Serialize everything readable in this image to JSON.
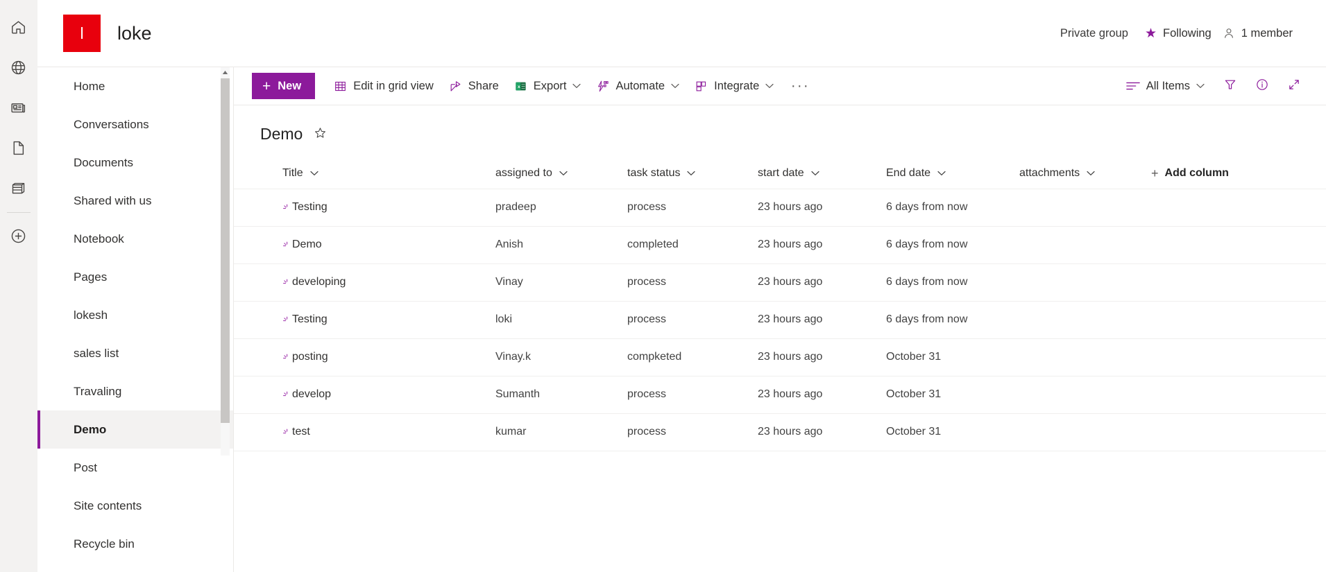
{
  "app_rail": {
    "items": [
      {
        "name": "home-icon",
        "label": "Home"
      },
      {
        "name": "globe-icon",
        "label": "My sites"
      },
      {
        "name": "news-icon",
        "label": "News"
      },
      {
        "name": "page-icon",
        "label": "Pages"
      },
      {
        "name": "lists-icon",
        "label": "Lists"
      }
    ],
    "create": {
      "name": "create-plus-icon",
      "label": "Create"
    }
  },
  "site": {
    "logo_letter": "l",
    "logo_color": "#e8000d",
    "title": "loke"
  },
  "group_meta": {
    "privacy": "Private group",
    "following_label": "Following",
    "following_icon": "star-filled-icon",
    "members_label": "1 member",
    "members_icon": "person-icon",
    "accent": "#8c1a9b"
  },
  "nav": {
    "items": [
      {
        "label": "Home",
        "active": false
      },
      {
        "label": "Conversations",
        "active": false
      },
      {
        "label": "Documents",
        "active": false
      },
      {
        "label": "Shared with us",
        "active": false
      },
      {
        "label": "Notebook",
        "active": false
      },
      {
        "label": "Pages",
        "active": false
      },
      {
        "label": "lokesh",
        "active": false
      },
      {
        "label": "sales list",
        "active": false
      },
      {
        "label": "Travaling",
        "active": false
      },
      {
        "label": "Demo",
        "active": true
      },
      {
        "label": "Post",
        "active": false
      },
      {
        "label": "Site contents",
        "active": false
      },
      {
        "label": "Recycle bin",
        "active": false
      }
    ]
  },
  "command_bar": {
    "new_label": "New",
    "new_plus": "+",
    "buttons": [
      {
        "label": "Edit in grid view",
        "icon": "grid-view-icon",
        "chevron": false
      },
      {
        "label": "Share",
        "icon": "share-icon",
        "chevron": false
      },
      {
        "label": "Export",
        "icon": "excel-export-icon",
        "chevron": true
      },
      {
        "label": "Automate",
        "icon": "automate-flow-icon",
        "chevron": true
      },
      {
        "label": "Integrate",
        "icon": "integrate-icon",
        "chevron": true
      }
    ],
    "overflow": "···",
    "view_label": "All Items",
    "view_icon": "list-view-icon",
    "filter_icon": "filter-funnel-icon",
    "info_icon": "info-circle-icon",
    "expand_icon": "expand-diagonal-icon"
  },
  "list": {
    "title": "Demo",
    "favorite_icon": "star-outline-icon",
    "columns": [
      "Title",
      "assigned to",
      "task status",
      "start date",
      "End date",
      "attachments"
    ],
    "add_column_label": "Add column",
    "add_column_plus": "+",
    "rows": [
      {
        "title": "Testing",
        "assigned_to": "pradeep",
        "task_status": "process",
        "start_date": "23 hours ago",
        "end_date": "6 days from now",
        "attachments": ""
      },
      {
        "title": "Demo",
        "assigned_to": "Anish",
        "task_status": "completed",
        "start_date": "23 hours ago",
        "end_date": "6 days from now",
        "attachments": ""
      },
      {
        "title": "developing",
        "assigned_to": "Vinay",
        "task_status": "process",
        "start_date": "23 hours ago",
        "end_date": "6 days from now",
        "attachments": ""
      },
      {
        "title": "Testing",
        "assigned_to": "loki",
        "task_status": "process",
        "start_date": "23 hours ago",
        "end_date": "6 days from now",
        "attachments": ""
      },
      {
        "title": "posting",
        "assigned_to": "Vinay.k",
        "task_status": "compketed",
        "start_date": "23 hours ago",
        "end_date": "October 31",
        "attachments": ""
      },
      {
        "title": "develop",
        "assigned_to": "Sumanth",
        "task_status": "process",
        "start_date": "23 hours ago",
        "end_date": "October 31",
        "attachments": ""
      },
      {
        "title": "test",
        "assigned_to": "kumar",
        "task_status": "process",
        "start_date": "23 hours ago",
        "end_date": "October 31",
        "attachments": ""
      }
    ]
  }
}
